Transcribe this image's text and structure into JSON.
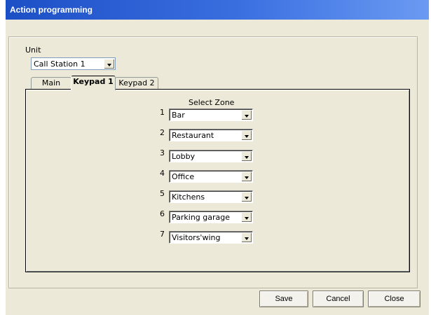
{
  "window": {
    "title": "Action programming"
  },
  "unit": {
    "label": "Unit",
    "selected": "Call Station 1"
  },
  "tabs": [
    {
      "label": "Main"
    },
    {
      "label": "Keypad 1"
    },
    {
      "label": "Keypad 2"
    }
  ],
  "zones": {
    "header": "Select Zone",
    "rows": [
      {
        "num": "1",
        "value": "Bar"
      },
      {
        "num": "2",
        "value": "Restaurant"
      },
      {
        "num": "3",
        "value": "Lobby"
      },
      {
        "num": "4",
        "value": "Office"
      },
      {
        "num": "5",
        "value": "Kitchens"
      },
      {
        "num": "6",
        "value": "Parking garage"
      },
      {
        "num": "7",
        "value": "Visitors'wing"
      }
    ]
  },
  "buttons": {
    "save": "Save",
    "cancel": "Cancel",
    "close": "Close"
  },
  "colors": {
    "titlebar": "#2a5fd8",
    "window_bg": "#ece9d8"
  }
}
